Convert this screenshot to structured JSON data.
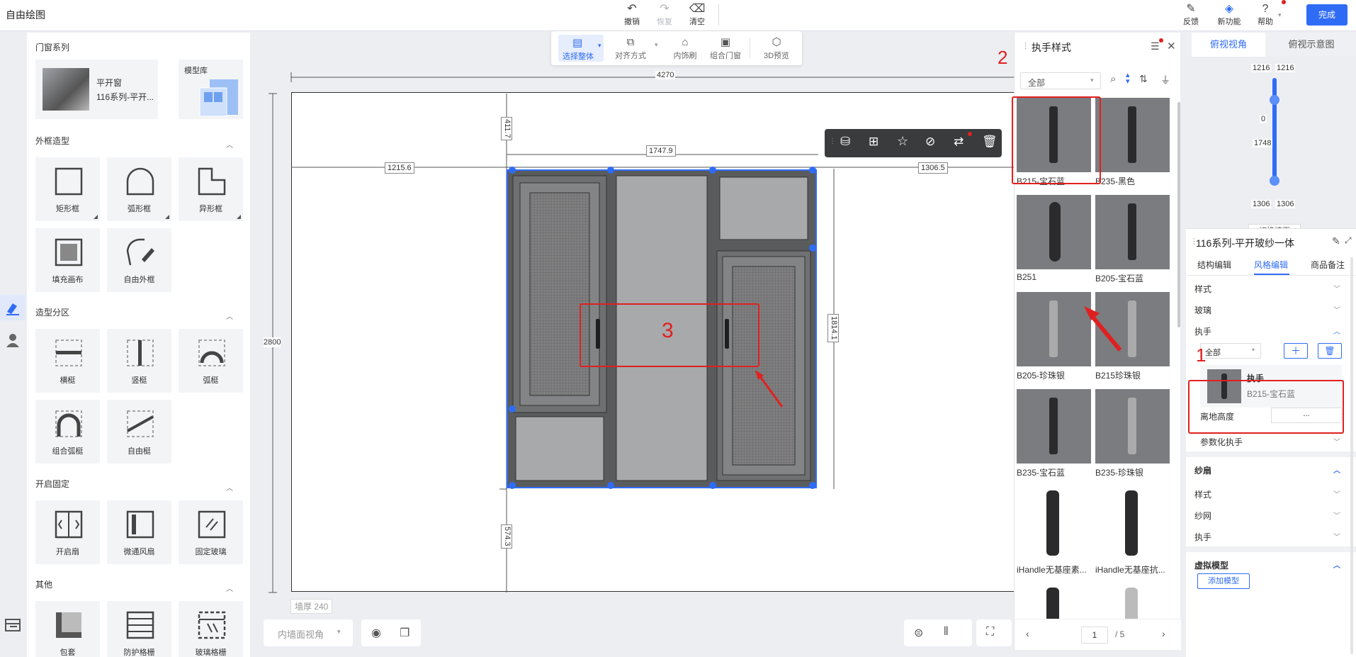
{
  "app_title": "自由绘图",
  "toolbar": {
    "undo": "撤销",
    "redo": "恢复",
    "clear": "清空",
    "feedback": "反馈",
    "new_features": "新功能",
    "help": "帮助",
    "done": "完成"
  },
  "left_panel": {
    "series_title": "门窗系列",
    "series_name": "平开窗",
    "series_sub": "116系列-平开...",
    "model_lib": "模型库",
    "frame_shape_title": "外框造型",
    "frame_shapes": [
      "矩形框",
      "弧形框",
      "异形框",
      "填充画布",
      "自由外框"
    ],
    "partition_title": "造型分区",
    "partitions": [
      "横梃",
      "竖梃",
      "弧梃",
      "组合弧梃",
      "自由梃"
    ],
    "opening_title": "开启固定",
    "openings": [
      "开启扇",
      "微通风扇",
      "固定玻璃"
    ],
    "other_title": "其他",
    "others": [
      "包套",
      "防护格栅",
      "玻璃格栅"
    ]
  },
  "float_toolbar": {
    "select_all": "选择整体",
    "align": "对齐方式",
    "decor_brush": "内饰刷",
    "combine": "组合门窗",
    "preview_3d": "3D预览"
  },
  "dimensions": {
    "total_width": "4270",
    "total_height": "2800",
    "left_gap": "1215.6",
    "window_width": "1747.9",
    "right_gap": "1306.5",
    "top_gap": "411.7",
    "window_height": "1814.1",
    "bottom_gap": "574.3",
    "wall_thickness": "墙厚 240"
  },
  "bottom_bar": {
    "view_select": "内墙面视角"
  },
  "handle_panel": {
    "title": "执手样式",
    "filter_value": "全部",
    "items": [
      "B215-宝石蓝",
      "B235-黑色",
      "B251",
      "B205-宝石蓝",
      "B205-珍珠银",
      "B215珍珠银",
      "B235-宝石蓝",
      "B235-珍珠银",
      "iHandle无基座素...",
      "iHandle无基座抗...",
      "",
      ""
    ],
    "page_current": "1",
    "page_total": "/ 5"
  },
  "right_panel": {
    "view_tabs": [
      "俯视视角",
      "俯视示意图"
    ],
    "top_dims": [
      "1216",
      "1216"
    ],
    "slider_top": "0",
    "slider_mid": "1748",
    "bottom_dims": [
      "1306",
      "1306"
    ],
    "switch_wall": "切换墙面",
    "product_title": "116系列-平开玻纱一体",
    "edit_tabs": [
      "结构编辑",
      "风格编辑",
      "商品备注"
    ],
    "rows": {
      "style": "样式",
      "glass": "玻璃",
      "handle": "执手",
      "filter_all": "全部",
      "handle_item_title": "执手",
      "handle_item_name": "B215-宝石蓝",
      "ground_height": "离地高度",
      "ground_value": "...",
      "param_handle": "参数化执手",
      "screen_sash": "纱扇",
      "screen_style": "样式",
      "screen_mesh": "纱网",
      "screen_handle": "执手",
      "virtual_model": "虚拟模型",
      "add_model": "添加模型"
    }
  },
  "annotations": {
    "n1": "1",
    "n2": "2",
    "n3": "3"
  },
  "colors": {
    "accent": "#2f6cf6",
    "annotation": "#e02020"
  }
}
